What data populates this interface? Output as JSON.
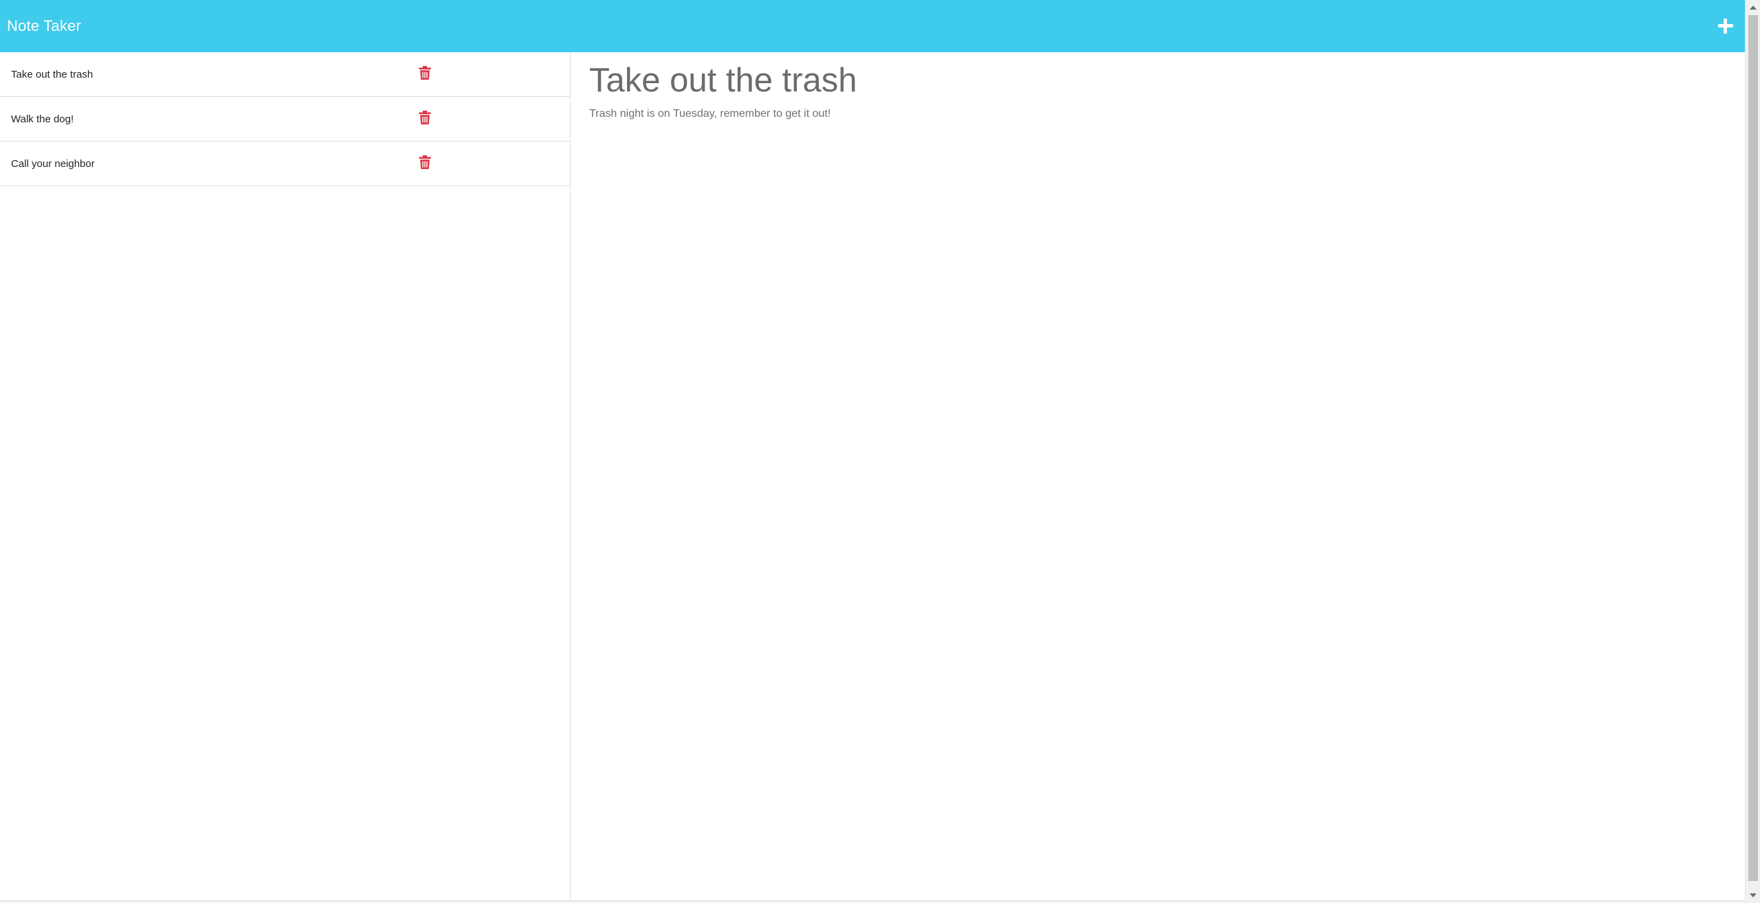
{
  "colors": {
    "navbar_bg": "#3ecbec",
    "delete_icon": "#dc3545"
  },
  "header": {
    "brand": "Note Taker",
    "new_note_icon": "plus-icon"
  },
  "notes": [
    {
      "title": "Take out the trash",
      "delete_icon": "trash-icon"
    },
    {
      "title": "Walk the dog!",
      "delete_icon": "trash-icon"
    },
    {
      "title": "Call your neighbor",
      "delete_icon": "trash-icon"
    }
  ],
  "active_note": {
    "title": "Take out the trash",
    "text": "Trash night is on Tuesday, remember to get it out!"
  }
}
